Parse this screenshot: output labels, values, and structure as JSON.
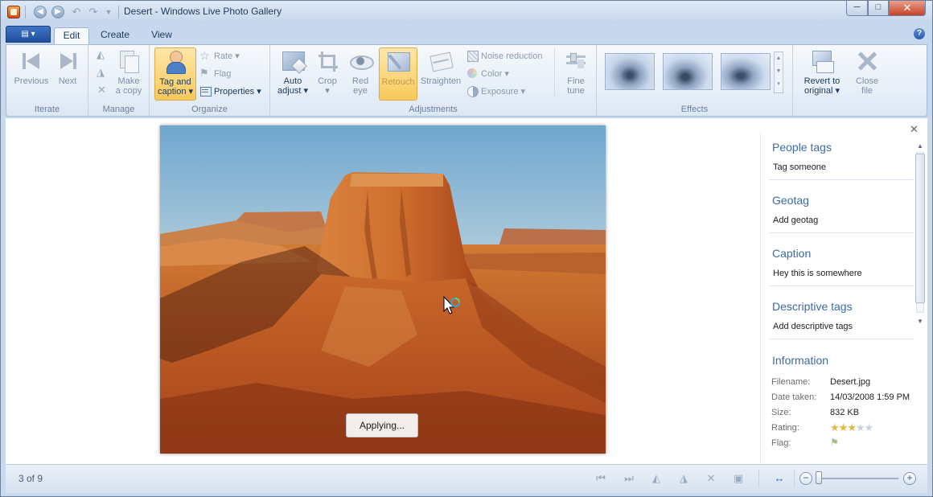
{
  "window": {
    "title": "Desert - Windows Live Photo Gallery",
    "minimize_icon": "minimize-icon",
    "maximize_icon": "maximize-icon",
    "close_icon": "close-icon"
  },
  "tabs": [
    {
      "label": "Edit",
      "active": true
    },
    {
      "label": "Create",
      "active": false
    },
    {
      "label": "View",
      "active": false
    }
  ],
  "ribbon": {
    "groups": {
      "iterate": "Iterate",
      "manage": "Manage",
      "organize": "Organize",
      "adjustments": "Adjustments",
      "effects": "Effects"
    },
    "previous": "Previous",
    "next": "Next",
    "make_copy_1": "Make",
    "make_copy_2": "a copy",
    "tag_caption_1": "Tag and",
    "tag_caption_2": "caption",
    "rate": "Rate",
    "flag": "Flag",
    "properties": "Properties",
    "auto_adjust_1": "Auto",
    "auto_adjust_2": "adjust",
    "crop": "Crop",
    "red_eye_1": "Red",
    "red_eye_2": "eye",
    "retouch": "Retouch",
    "straighten": "Straighten",
    "noise_reduction": "Noise reduction",
    "color": "Color",
    "exposure": "Exposure",
    "fine_tune_1": "Fine",
    "fine_tune_2": "tune",
    "revert_1": "Revert to",
    "revert_2": "original",
    "close_file_1": "Close",
    "close_file_2": "file"
  },
  "status": {
    "applying": "Applying..."
  },
  "infopane": {
    "people_tags_title": "People tags",
    "people_tags_value": "Tag someone",
    "geotag_title": "Geotag",
    "geotag_value": "Add geotag",
    "caption_title": "Caption",
    "caption_value": "Hey this is somewhere",
    "descriptive_title": "Descriptive tags",
    "descriptive_value": "Add descriptive tags",
    "information_title": "Information",
    "filename_label": "Filename:",
    "filename_value": "Desert.jpg",
    "date_label": "Date taken:",
    "date_value": "14/03/2008  1:59 PM",
    "size_label": "Size:",
    "size_value": "832 KB",
    "rating_label": "Rating:",
    "rating_stars": 3,
    "rating_max": 5,
    "flag_label": "Flag:"
  },
  "statusbar": {
    "page_count": "3 of 9"
  },
  "colors": {
    "accent": "#3b6aa6",
    "highlight": "#f8c95b",
    "frame": "#c9d9ee"
  }
}
